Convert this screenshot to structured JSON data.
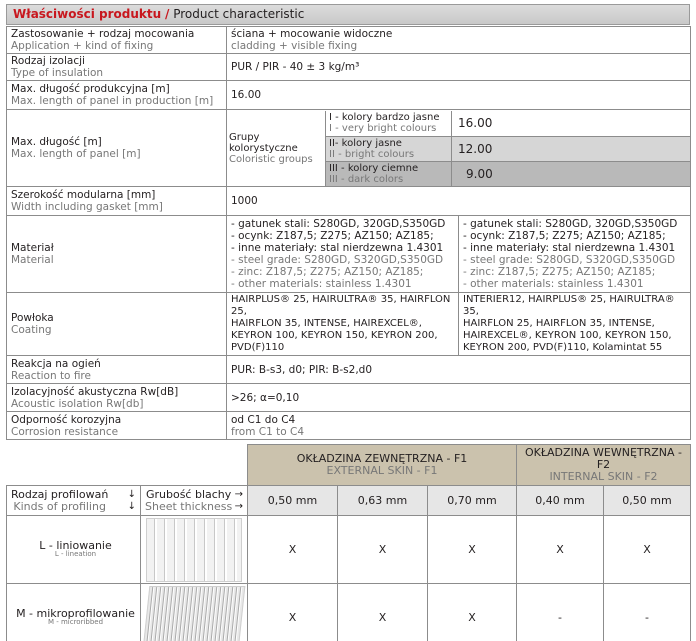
{
  "header": {
    "title_pl": "Właściwości produktu",
    "separator": "/",
    "title_en": "Product characteristic"
  },
  "spec": {
    "application": {
      "label_pl": "Zastosowanie + rodzaj mocowania",
      "label_en": "Application + kind of fixing",
      "value_pl": "ściana + mocowanie widoczne",
      "value_en": "cladding + visible fixing"
    },
    "insulation": {
      "label_pl": "Rodzaj izolacji",
      "label_en": "Type of insulation",
      "value": "PUR / PIR - 40 ± 3 kg/m³"
    },
    "max_length_production": {
      "label_pl": "Max. długość produkcyjna [m]",
      "label_en": "Max. length of panel in production [m]",
      "value": "16.00"
    },
    "max_length": {
      "label_pl": "Max. długość [m]",
      "label_en": "Max. length of panel [m]",
      "groups_label_pl": "Grupy kolorystyczne",
      "groups_label_en": "Coloristic groups",
      "groups": [
        {
          "name_pl": "I - kolory bardzo jasne",
          "name_en": "I - very bright colours",
          "value": "16.00"
        },
        {
          "name_pl": "II- kolory jasne",
          "name_en": "II - bright colours",
          "value": "12.00"
        },
        {
          "name_pl": "III - kolory ciemne",
          "name_en": "III - dark colors",
          "value": "9.00"
        }
      ]
    },
    "width": {
      "label_pl": "Szerokość modularna [mm]",
      "label_en": "Width including gasket [mm]",
      "value": "1000"
    },
    "material": {
      "label_pl": "Materiał",
      "label_en": "Material",
      "left": {
        "pl": [
          "- gatunek stali: S280GD, 320GD,S350GD",
          "- ocynk: Z187,5; Z275; AZ150;  AZ185;",
          "- inne materiały: stal nierdzewna 1.4301"
        ],
        "en": [
          "- steel grade: S280GD, S320GD,S350GD",
          "- zinc: Z187,5; Z275; AZ150;  AZ185;",
          "- other materials: stainless 1.4301"
        ]
      },
      "right": {
        "pl": [
          "- gatunek stali: S280GD, 320GD,S350GD",
          "- ocynk: Z187,5; Z275; AZ150;  AZ185;",
          "- inne materiały: stal nierdzewna 1.4301"
        ],
        "en": [
          "- steel grade: S280GD, S320GD,S350GD",
          "- zinc: Z187,5; Z275; AZ150;  AZ185;",
          "- other materials: stainless 1.4301"
        ]
      }
    },
    "coating": {
      "label_pl": "Powłoka",
      "label_en": "Coating",
      "left": [
        "HAIRPLUS® 25, HAIRULTRA® 35, HAIRFLON 25,",
        "HAIRFLON 35, INTENSE, HAIREXCEL®,",
        "KEYRON 100, KEYRON 150, KEYRON  200,",
        "PVD(F)110"
      ],
      "right": [
        "INTERIER12, HAIRPLUS® 25, HAIRULTRA® 35,",
        "HAIRFLON 25, HAIRFLON 35, INTENSE,",
        "HAIREXCEL®, KEYRON 100, KEYRON 150,",
        "KEYRON  200, PVD(F)110, Kolamintat 55"
      ]
    },
    "fire": {
      "label_pl": "Reakcja na ogień",
      "label_en": "Reaction to fire",
      "value": "PUR: B-s3, d0; PIR: B-s2,d0"
    },
    "acoustic": {
      "label_pl": "Izolacyjność akustyczna Rw[dB]",
      "label_en": "Acoustic isolation Rw[db]",
      "value": ">26; α=0,10"
    },
    "corrosion": {
      "label_pl": "Odporność korozyjna",
      "label_en": "Corrosion resistance",
      "value_pl": "od C1 do C4",
      "value_en": "from C1 to C4"
    }
  },
  "profiles": {
    "kinds_pl": "Rodzaj profilowań",
    "kinds_en": "Kinds of profiling",
    "thickness_pl": "Grubość blachy",
    "thickness_en": "Sheet thickness",
    "arrow_down": "↓",
    "arrow_right": "→",
    "f1_pl": "OKŁADZINA ZEWNĘTRZNA - F1",
    "f1_en": "EXTERNAL SKIN - F1",
    "f2_pl": "OKŁADZINA WEWNĘTRZNA - F2",
    "f2_en": "INTERNAL SKIN - F2",
    "thicknesses": [
      "0,50 mm",
      "0,63 mm",
      "0,70 mm",
      "0,40 mm",
      "0,50 mm"
    ],
    "rows": [
      {
        "name_pl": "L - liniowanie",
        "name_en": "L - lineation",
        "marks": [
          "X",
          "X",
          "X",
          "X",
          "X"
        ]
      },
      {
        "name_pl": "M - mikroprofilowanie",
        "name_en": "M - microribbed",
        "marks": [
          "X",
          "X",
          "X",
          "-",
          "-"
        ]
      }
    ]
  }
}
